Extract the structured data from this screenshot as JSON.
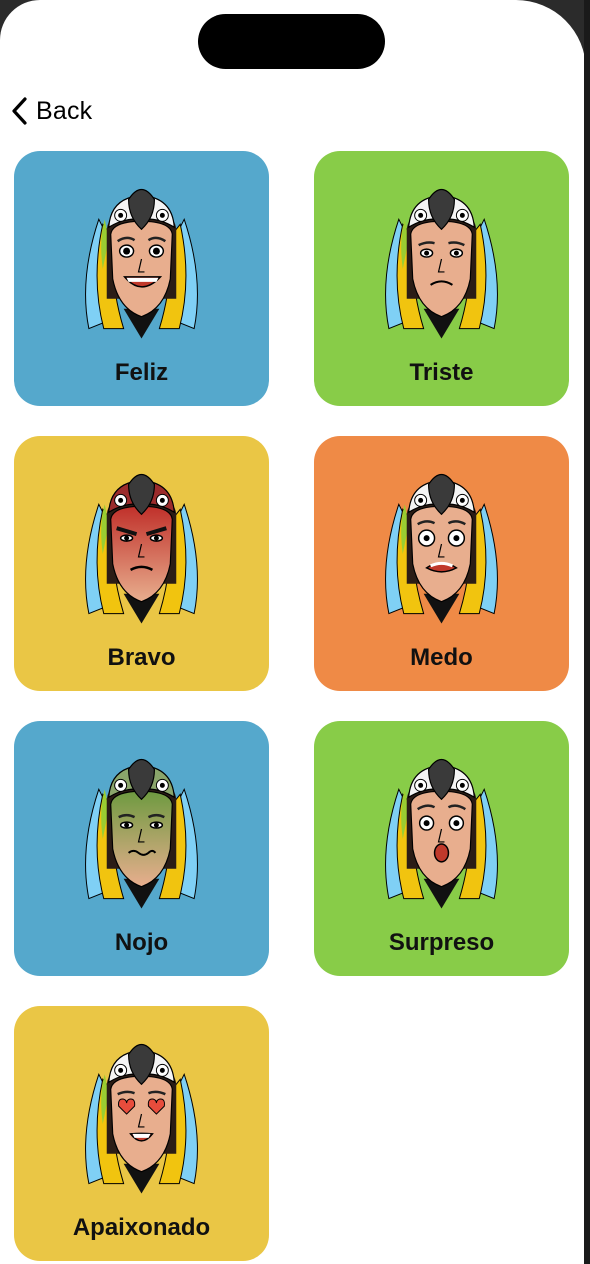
{
  "nav": {
    "back_label": "Back"
  },
  "colors": {
    "blue": "#55a8cc",
    "green": "#88cc48",
    "yellow": "#eac645",
    "orange": "#ef8a46"
  },
  "emotions": [
    {
      "label": "Feliz",
      "color": "blue",
      "expression": "happy"
    },
    {
      "label": "Triste",
      "color": "green",
      "expression": "sad"
    },
    {
      "label": "Bravo",
      "color": "yellow",
      "expression": "angry"
    },
    {
      "label": "Medo",
      "color": "orange",
      "expression": "scared"
    },
    {
      "label": "Nojo",
      "color": "blue",
      "expression": "disgusted"
    },
    {
      "label": "Surpreso",
      "color": "green",
      "expression": "surprised"
    },
    {
      "label": "Apaixonado",
      "color": "yellow",
      "expression": "in-love"
    }
  ]
}
